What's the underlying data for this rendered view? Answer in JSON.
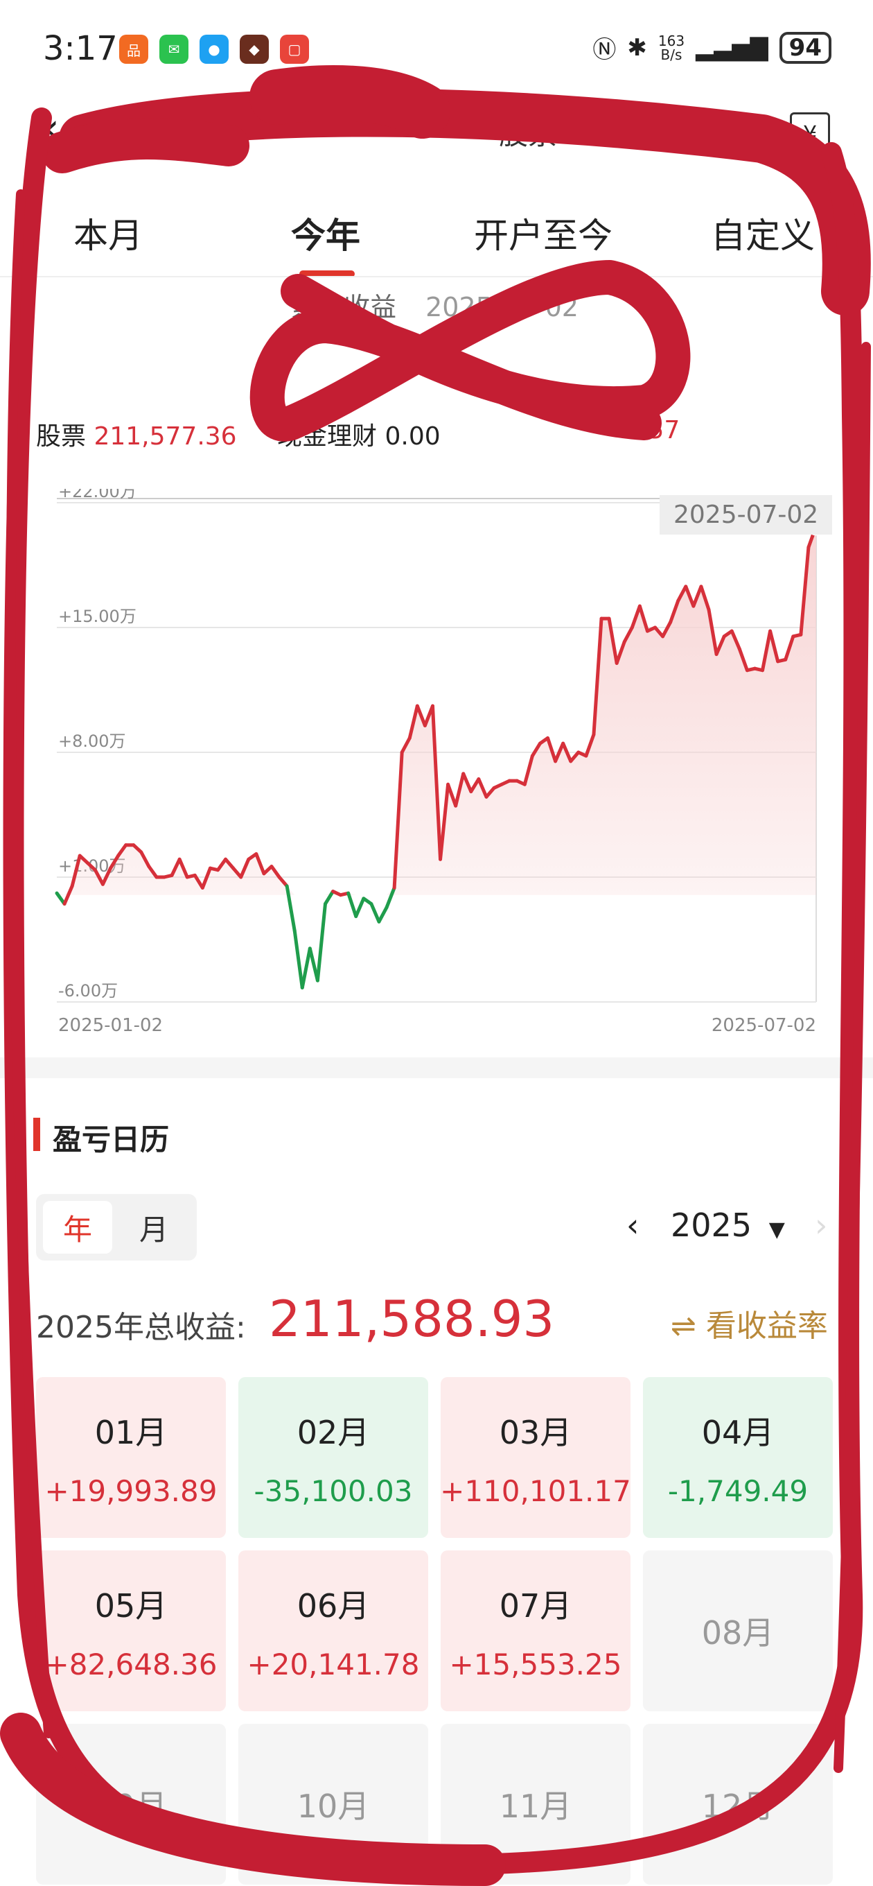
{
  "status_bar": {
    "time": "3:17",
    "net_speed_value": "163",
    "net_speed_unit": "B/s",
    "battery": "94",
    "icons": [
      "nfc-icon",
      "bluetooth-icon",
      "signal-icon"
    ]
  },
  "header": {
    "title_partial": "股票",
    "right_icon": "receipt-yen-icon"
  },
  "tabs": [
    {
      "label": "本月"
    },
    {
      "label": "今年"
    },
    {
      "label": "开户至今"
    },
    {
      "label": "自定义"
    }
  ],
  "summary": {
    "label": "累计收益",
    "date": "2025-07-02"
  },
  "breakdown": {
    "stocks_label": "股票",
    "stocks_value": "211,577.36",
    "fund_label": "现金理财",
    "fund_value": "0.00",
    "other_value_tail": ".57"
  },
  "chart_data": {
    "type": "area",
    "x_start": "2025-01-02",
    "x_end": "2025-07-02",
    "ytick_labels": [
      "+22.00万",
      "+15.00万",
      "+8.00万",
      "+1.00万",
      "-6.00万"
    ],
    "yticks": [
      22,
      15,
      8,
      1,
      -6
    ],
    "ylim": [
      -6,
      22
    ],
    "baseline": 0,
    "highlight_date": "2025-07-02",
    "colors": {
      "positive": "#d6303a",
      "negative": "#1f9d4c",
      "fill": "#f7d2d2"
    },
    "y": [
      0.1,
      -0.5,
      0.5,
      2.2,
      1.8,
      1.4,
      0.6,
      1.5,
      2.2,
      2.8,
      2.8,
      2.4,
      1.6,
      1.0,
      1.0,
      1.1,
      2.0,
      1.0,
      1.1,
      0.4,
      1.5,
      1.4,
      2.0,
      1.5,
      1.0,
      2.0,
      2.3,
      1.2,
      1.6,
      1.0,
      0.5,
      -2.0,
      -5.2,
      -3.0,
      -4.8,
      -0.5,
      0.2,
      0.0,
      0.1,
      -1.2,
      -0.2,
      -0.5,
      -1.5,
      -0.7,
      0.4,
      8.0,
      8.8,
      10.6,
      9.5,
      10.6,
      2.0,
      6.2,
      5.0,
      6.8,
      5.8,
      6.5,
      5.5,
      6.0,
      6.2,
      6.4,
      6.4,
      6.2,
      7.8,
      8.5,
      8.8,
      7.5,
      8.5,
      7.5,
      8.0,
      7.8,
      9.0,
      15.5,
      15.5,
      13.0,
      14.2,
      15.0,
      16.2,
      14.8,
      15.0,
      14.5,
      15.3,
      16.5,
      17.3,
      16.2,
      17.3,
      16.0,
      13.5,
      14.5,
      14.8,
      13.8,
      12.6,
      12.7,
      12.6,
      14.8,
      13.1,
      13.2,
      14.5,
      14.6,
      19.5,
      20.7
    ]
  },
  "calendar": {
    "section_title": "盈亏日历",
    "seg_year": "年",
    "seg_month": "月",
    "prev_icon": "‹",
    "year": "2025",
    "total_label": "2025年总收益:",
    "total_value": "211,588.93",
    "rate_icon": "⇌",
    "rate_label": "看收益率",
    "months": [
      {
        "m": "01月",
        "v": "+19,993.89",
        "s": "pos"
      },
      {
        "m": "02月",
        "v": "-35,100.03",
        "s": "neg"
      },
      {
        "m": "03月",
        "v": "+110,101.17",
        "s": "pos"
      },
      {
        "m": "04月",
        "v": "-1,749.49",
        "s": "neg"
      },
      {
        "m": "05月",
        "v": "+82,648.36",
        "s": "pos"
      },
      {
        "m": "06月",
        "v": "+20,141.78",
        "s": "pos"
      },
      {
        "m": "07月",
        "v": "+15,553.25",
        "s": "pos"
      },
      {
        "m": "08月",
        "v": "",
        "s": "empty"
      },
      {
        "m": "09月",
        "v": "",
        "s": "empty"
      },
      {
        "m": "10月",
        "v": "",
        "s": "empty"
      },
      {
        "m": "11月",
        "v": "",
        "s": "empty"
      },
      {
        "m": "12月",
        "v": "",
        "s": "empty"
      }
    ]
  }
}
